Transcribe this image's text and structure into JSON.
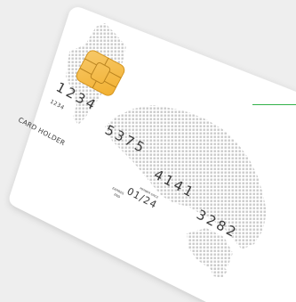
{
  "colors": {
    "background": "#eeeeee",
    "card": "#ffffff",
    "map_dots": "#c9c9c9",
    "chip_gold": "#f2b030",
    "chip_gold_light": "#f7c96a",
    "chip_line": "#b07a18",
    "text": "#3a3a3a",
    "accent_line": "#33b24a"
  },
  "card": {
    "number_group_1": "1234",
    "number_group_2": "5375",
    "number_group_3": "4141",
    "number_group_4": "3282",
    "small_number": "1234",
    "expires_label_1": "EXPIRES",
    "expires_label_2": "END",
    "member_since_label": "MEMBER SINCE",
    "expiry_date": "01/24",
    "holder": "CARD HOLDER"
  }
}
